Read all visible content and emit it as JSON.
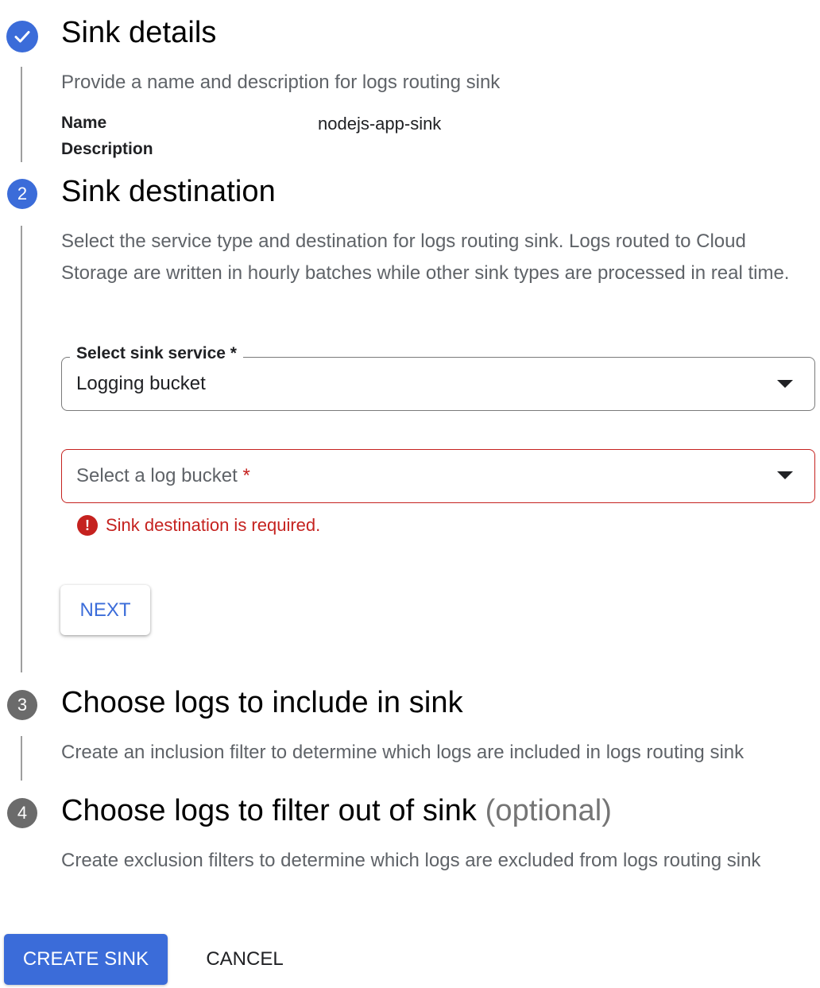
{
  "colors": {
    "accent": "#3b6cd9",
    "error": "#c5221f",
    "inactive_step": "#6b6b6b"
  },
  "step1": {
    "icon": "check-icon",
    "title": "Sink details",
    "description": "Provide a name and description for logs routing sink",
    "name_label": "Name",
    "name_value": "nodejs-app-sink",
    "description_label": "Description"
  },
  "step2": {
    "number": "2",
    "title": "Sink destination",
    "description": "Select the service type and destination for logs routing sink. Logs routed to Cloud Storage are written in hourly batches while other sink types are processed in real time.",
    "sink_service": {
      "label": "Select sink service *",
      "value": "Logging bucket"
    },
    "log_bucket": {
      "placeholder": "Select a log bucket ",
      "required_mark": "*"
    },
    "error_icon": "error-icon",
    "error_glyph": "!",
    "error_message": "Sink destination is required.",
    "next_label": "NEXT"
  },
  "step3": {
    "number": "3",
    "title": "Choose logs to include in sink",
    "description": "Create an inclusion filter to determine which logs are included in logs routing sink"
  },
  "step4": {
    "number": "4",
    "title": "Choose logs to filter out of sink ",
    "title_suffix": "(optional)",
    "description": "Create exclusion filters to determine which logs are excluded from logs routing sink"
  },
  "footer": {
    "create_label": "CREATE SINK",
    "cancel_label": "CANCEL"
  }
}
